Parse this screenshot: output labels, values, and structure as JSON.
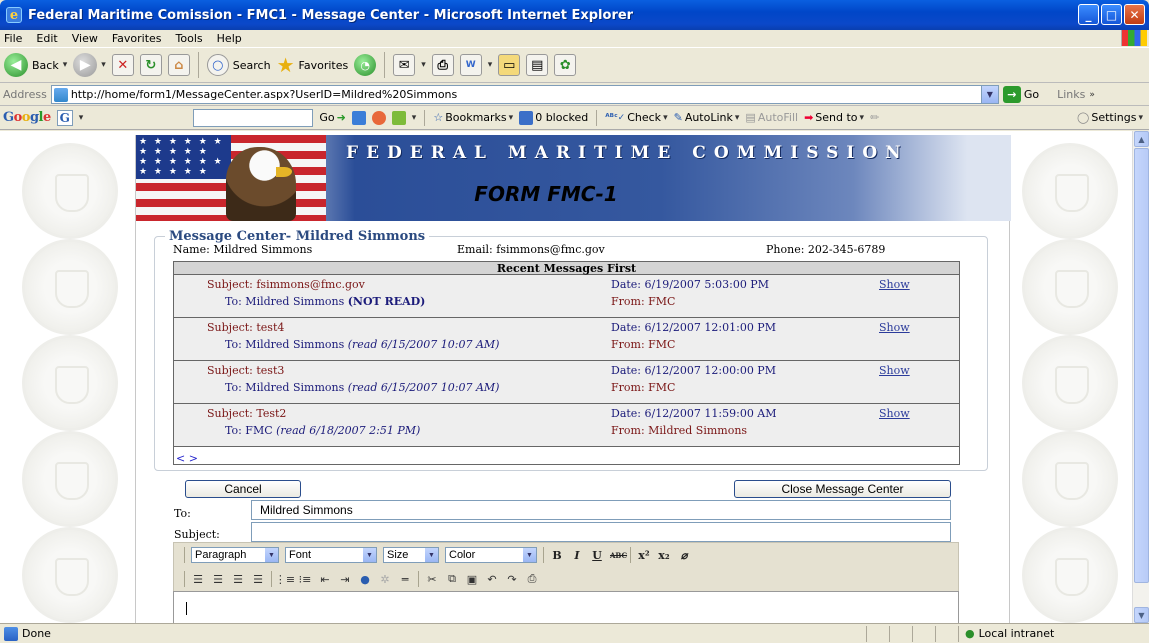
{
  "window": {
    "title": "Federal Maritime Comission - FMC1 - Message Center - Microsoft Internet Explorer"
  },
  "menu": [
    "File",
    "Edit",
    "View",
    "Favorites",
    "Tools",
    "Help"
  ],
  "toolbar": {
    "back": "Back",
    "search": "Search",
    "favorites": "Favorites"
  },
  "address": {
    "label": "Address",
    "url": "http://home/form1/MessageCenter.aspx?UserID=Mildred%20Simmons",
    "go": "Go",
    "links": "Links"
  },
  "google": {
    "logo": "Google",
    "go": "Go",
    "bookmarks": "Bookmarks",
    "blocked": "0 blocked",
    "check": "Check",
    "autolink": "AutoLink",
    "autofill": "AutoFill",
    "sendto": "Send to",
    "settings": "Settings"
  },
  "page": {
    "banner_title": "FEDERAL MARITIME COMMISSION",
    "form_title": "FORM FMC-1",
    "legend": "Message Center- Mildred Simmons",
    "name": "Name: Mildred Simmons",
    "email": "Email: fsimmons@fmc.gov",
    "phone": "Phone: 202-345-6789",
    "table_header": "Recent Messages First",
    "messages": [
      {
        "subject": "Subject: fsimmons@fmc.gov",
        "to_prefix": "To: Mildred Simmons ",
        "to_status": "(NOT READ)",
        "date": "Date: 6/19/2007 5:03:00 PM",
        "from": "From: FMC",
        "show": "Show"
      },
      {
        "subject": "Subject: test4",
        "to_prefix": "To: Mildred Simmons ",
        "to_status": "(read 6/15/2007 10:07 AM)",
        "date": "Date: 6/12/2007 12:01:00 PM",
        "from": "From: FMC",
        "show": "Show"
      },
      {
        "subject": "Subject: test3",
        "to_prefix": "To: Mildred Simmons ",
        "to_status": "(read 6/15/2007 10:07 AM)",
        "date": "Date: 6/12/2007 12:00:00 PM",
        "from": "From: FMC",
        "show": "Show"
      },
      {
        "subject": "Subject: Test2",
        "to_prefix": "To: FMC ",
        "to_status": "(read 6/18/2007 2:51 PM)",
        "date": "Date: 6/12/2007 11:59:00 AM",
        "from": "From: Mildred Simmons",
        "show": "Show"
      }
    ],
    "pager": "< >",
    "cancel": "Cancel",
    "close": "Close Message Center",
    "to_label": "To:",
    "to_value": "Mildred Simmons",
    "subject_label": "Subject:",
    "editor": {
      "paragraph": "Paragraph",
      "font": "Font",
      "size": "Size",
      "color": "Color"
    }
  },
  "status": {
    "done": "Done",
    "zone": "Local intranet"
  }
}
